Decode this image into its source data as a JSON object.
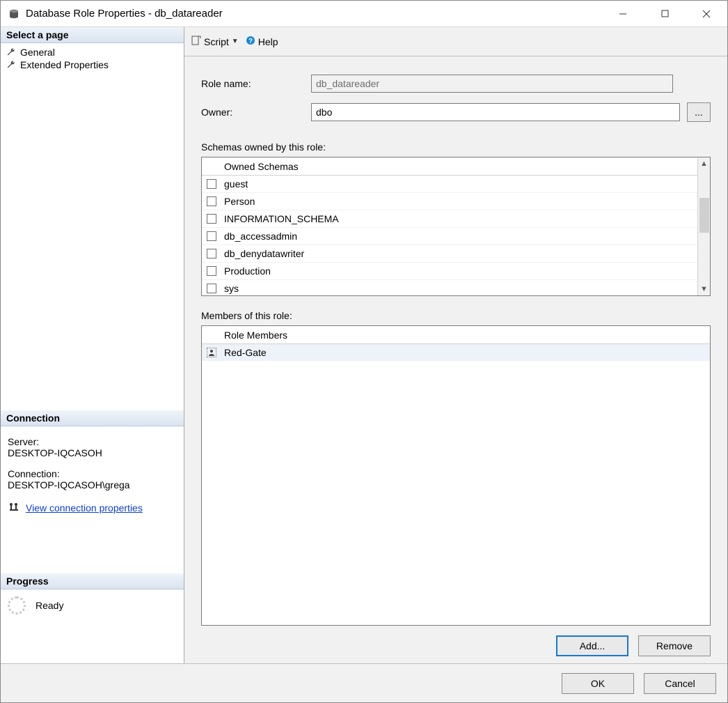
{
  "window": {
    "title": "Database Role Properties - db_datareader"
  },
  "left": {
    "select_page_header": "Select a page",
    "pages": [
      {
        "label": "General"
      },
      {
        "label": "Extended Properties"
      }
    ],
    "connection_header": "Connection",
    "server_label": "Server:",
    "server_value": "DESKTOP-IQCASOH",
    "connection_label": "Connection:",
    "connection_value": "DESKTOP-IQCASOH\\grega",
    "view_conn_link": "View connection properties",
    "progress_header": "Progress",
    "progress_status": "Ready"
  },
  "toolbar": {
    "script_label": "Script",
    "help_label": "Help"
  },
  "form": {
    "role_name_label": "Role name:",
    "role_name_value": "db_datareader",
    "owner_label": "Owner:",
    "owner_value": "dbo",
    "browse_label": "...",
    "schemas_section": "Schemas owned by this role:",
    "schemas_header": "Owned Schemas",
    "schemas": [
      {
        "name": "guest",
        "checked": false
      },
      {
        "name": "Person",
        "checked": false
      },
      {
        "name": "INFORMATION_SCHEMA",
        "checked": false
      },
      {
        "name": "db_accessadmin",
        "checked": false
      },
      {
        "name": "db_denydatawriter",
        "checked": false
      },
      {
        "name": "Production",
        "checked": false
      },
      {
        "name": "sys",
        "checked": false
      }
    ],
    "members_section": "Members of this role:",
    "members_header": "Role Members",
    "members": [
      {
        "name": "Red-Gate"
      }
    ],
    "add_button": "Add...",
    "remove_button": "Remove"
  },
  "footer": {
    "ok": "OK",
    "cancel": "Cancel"
  }
}
